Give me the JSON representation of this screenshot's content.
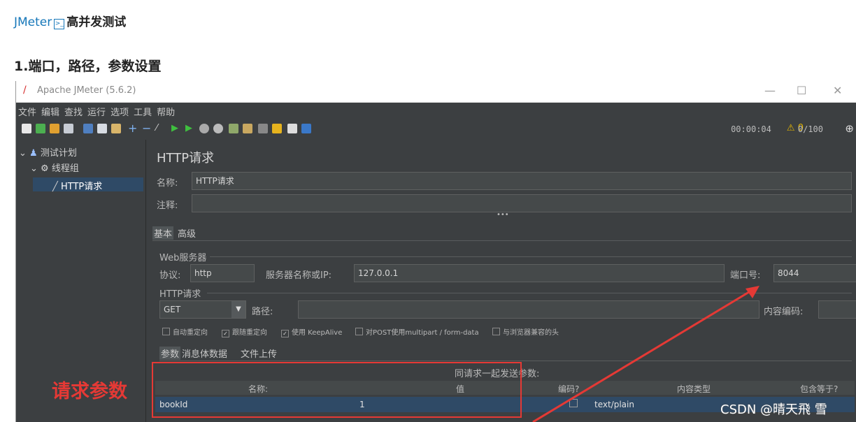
{
  "article": {
    "breadcrumb_link": "JMeter",
    "breadcrumb_title": "高并发测试",
    "section_title": "1.端口，路径，参数设置",
    "annotation": "请求参数",
    "watermark": "CSDN @晴天飛 雪"
  },
  "window": {
    "title": "Apache JMeter (5.6.2)",
    "menu": [
      "文件",
      "编辑",
      "查找",
      "运行",
      "选项",
      "工具",
      "帮助"
    ],
    "status": {
      "timer": "00:00:04",
      "warnings": "0",
      "threads": "0/100"
    }
  },
  "tree": {
    "items": [
      {
        "label": "测试计划",
        "icon": "flask-icon"
      },
      {
        "label": "线程组",
        "icon": "gear-icon"
      },
      {
        "label": "HTTP请求",
        "icon": "pen-icon"
      }
    ]
  },
  "panel": {
    "heading": "HTTP请求",
    "name_label": "名称:",
    "name_value": "HTTP请求",
    "comment_label": "注释:",
    "comment_value": "",
    "tabs": [
      "基本",
      "高级"
    ],
    "web_server_group": "Web服务器",
    "protocol_label": "协议:",
    "protocol_value": "http",
    "server_label": "服务器名称或IP:",
    "server_value": "127.0.0.1",
    "port_label": "端口号:",
    "port_value": "8044",
    "http_group": "HTTP请求",
    "method_value": "GET",
    "path_label": "路径:",
    "path_value": "",
    "encoding_label": "内容编码:",
    "encoding_value": "",
    "checkboxes": [
      {
        "label": "自动重定向",
        "checked": false
      },
      {
        "label": "跟随重定向",
        "checked": true
      },
      {
        "label": "使用 KeepAlive",
        "checked": true
      },
      {
        "label": "对POST使用multipart / form-data",
        "checked": false
      },
      {
        "label": "与浏览器兼容的头",
        "checked": false
      }
    ],
    "subtabs": [
      "参数",
      "消息体数据",
      "文件上传"
    ],
    "params_caption": "同请求一起发送参数:",
    "table_headers": [
      "名称:",
      "值",
      "编码?",
      "内容类型",
      "包含等于?"
    ],
    "table_rows": [
      {
        "name": "bookId",
        "value": "1",
        "encode": false,
        "content_type": "text/plain",
        "include_equals": true
      }
    ]
  },
  "colors": {
    "accent_red": "#e53935",
    "link_blue": "#1677b9",
    "dark_bg": "#3c3f41"
  }
}
